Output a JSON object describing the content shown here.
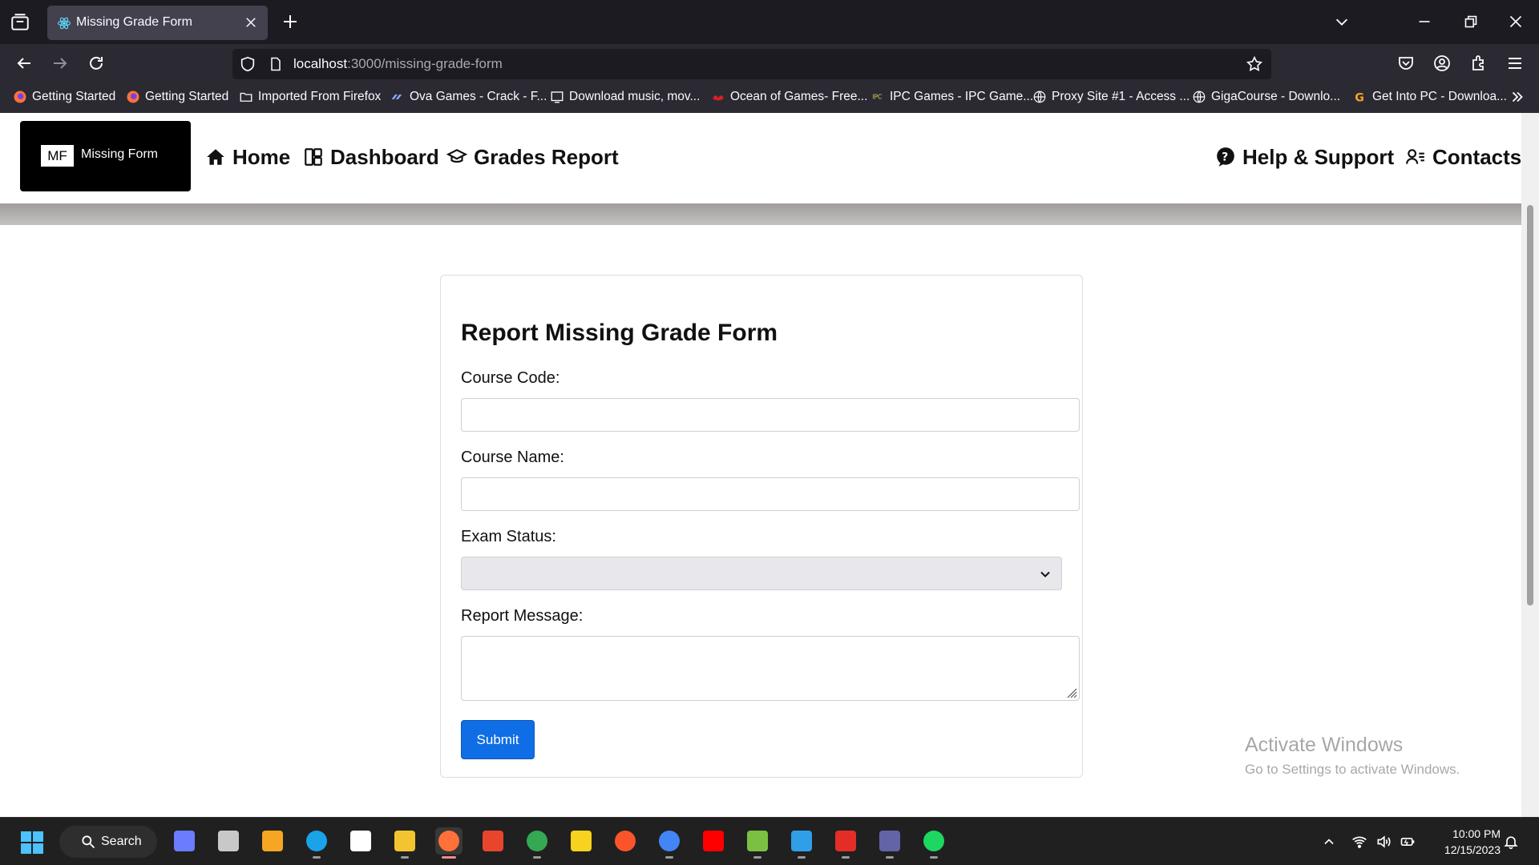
{
  "browser": {
    "tab_title": "Missing Grade Form",
    "url_host": "localhost",
    "url_path": ":3000/missing-grade-form",
    "bookmarks": [
      {
        "label": "Getting Started",
        "icon": "firefox-icon"
      },
      {
        "label": "Getting Started",
        "icon": "firefox-icon"
      },
      {
        "label": "Imported From Firefox",
        "icon": "folder-icon"
      },
      {
        "label": "Ova Games - Crack - F...",
        "icon": "ova-games-icon"
      },
      {
        "label": "Download music, mov...",
        "icon": "download-site-icon"
      },
      {
        "label": "Ocean of Games- Free...",
        "icon": "ocean-of-games-icon"
      },
      {
        "label": "IPC Games - IPC Game...",
        "icon": "ipc-games-icon"
      },
      {
        "label": "Proxy Site #1 - Access ...",
        "icon": "globe-icon"
      },
      {
        "label": "GigaCourse - Downlo...",
        "icon": "globe-icon"
      },
      {
        "label": "Get Into PC - Downloa...",
        "icon": "get-into-pc-icon"
      }
    ]
  },
  "app": {
    "brand_mark": "MF",
    "brand_name": "Missing Form",
    "nav_left": [
      {
        "label": "Home",
        "icon": "home-icon"
      },
      {
        "label": "Dashboard",
        "icon": "dashboard-icon"
      },
      {
        "label": "Grades Report",
        "icon": "graduation-cap-icon"
      }
    ],
    "nav_right": [
      {
        "label": "Help & Support",
        "icon": "question-icon"
      },
      {
        "label": "Contacts",
        "icon": "contacts-icon"
      }
    ]
  },
  "form": {
    "title": "Report Missing Grade Form",
    "course_code_label": "Course Code:",
    "course_code_value": "",
    "course_name_label": "Course Name:",
    "course_name_value": "",
    "exam_status_label": "Exam Status:",
    "exam_status_value": "",
    "report_message_label": "Report Message:",
    "report_message_value": "",
    "submit_label": "Submit"
  },
  "watermark": {
    "title": "Activate Windows",
    "subtitle": "Go to Settings to activate Windows."
  },
  "taskbar": {
    "search_label": "Search",
    "time": "10:00 PM",
    "date": "12/15/2023",
    "apps": [
      {
        "name": "copilot-icon",
        "color": "#6b7cff"
      },
      {
        "name": "task-view-icon",
        "color": "#c8c8c8"
      },
      {
        "name": "widgets-icon",
        "color": "#f6a623"
      },
      {
        "name": "edge-icon",
        "color": "#1aa3e8"
      },
      {
        "name": "microsoft-store-icon",
        "color": "#ffffff"
      },
      {
        "name": "file-explorer-icon",
        "color": "#f4c430"
      },
      {
        "name": "firefox-icon",
        "color": "#ff7139"
      },
      {
        "name": "creative-cloud-icon",
        "color": "#e8452c"
      },
      {
        "name": "chrome-icon",
        "color": "#34a853"
      },
      {
        "name": "sticky-notes-icon",
        "color": "#f7d21e"
      },
      {
        "name": "brave-icon",
        "color": "#fb542b"
      },
      {
        "name": "chrome-icon",
        "color": "#4285f4"
      },
      {
        "name": "youtube-icon",
        "color": "#ff0000"
      },
      {
        "name": "bluestacks-icon",
        "color": "#7bc043"
      },
      {
        "name": "vscode-icon",
        "color": "#2f9fe8"
      },
      {
        "name": "acrobat-icon",
        "color": "#e52d27"
      },
      {
        "name": "teams-icon",
        "color": "#6264a7"
      },
      {
        "name": "spotify-icon",
        "color": "#1ed760"
      }
    ]
  },
  "colors": {
    "submit_button": "#0f6ee5",
    "brand_bg": "#000000",
    "browser_toolbar": "#2b2a33",
    "tab_strip": "#1c1b22"
  }
}
